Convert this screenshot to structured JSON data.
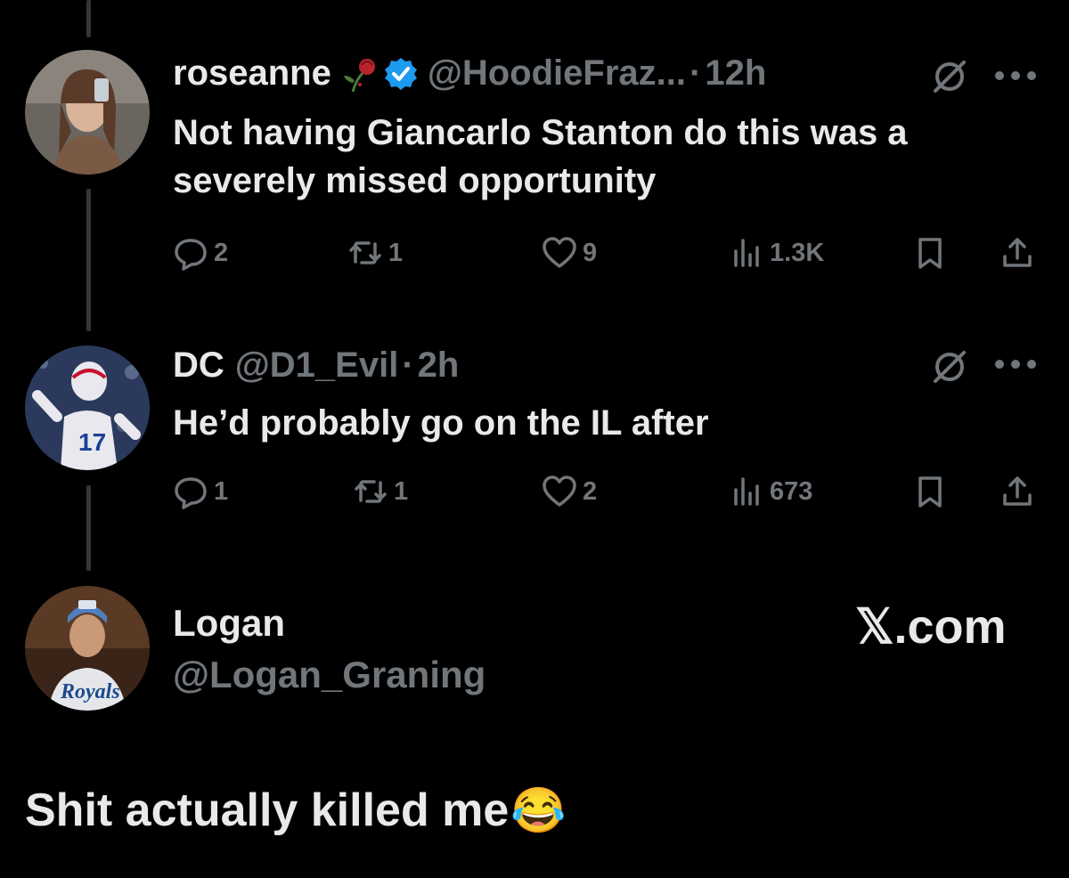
{
  "tweets": [
    {
      "name": "roseanne",
      "handle": "@HoodieFraz...",
      "dot": "·",
      "time": "12h",
      "text": "Not having Giancarlo Stanton do this was a severely missed opportunity",
      "replies": "2",
      "retweets": "1",
      "likes": "9",
      "views": "1.3K"
    },
    {
      "name": "DC",
      "handle": "@D1_Evil",
      "dot": "·",
      "time": "2h",
      "text": "He’d probably go on the IL after",
      "replies": "1",
      "retweets": "1",
      "likes": "2",
      "views": "673"
    }
  ],
  "author": {
    "name": "Logan",
    "handle": "@Logan_Graning"
  },
  "watermark": "𝕏.com",
  "caption": "Shit actually killed me",
  "caption_emoji": "😂",
  "colors": {
    "background": "#000000",
    "text": "#e7e9ea",
    "muted": "#71767b",
    "verified": "#1d9bf0"
  },
  "icons": [
    "rose-icon",
    "verified-icon",
    "grok-icon",
    "more-icon",
    "reply-icon",
    "retweet-icon",
    "like-icon",
    "views-icon",
    "bookmark-icon",
    "share-icon"
  ]
}
